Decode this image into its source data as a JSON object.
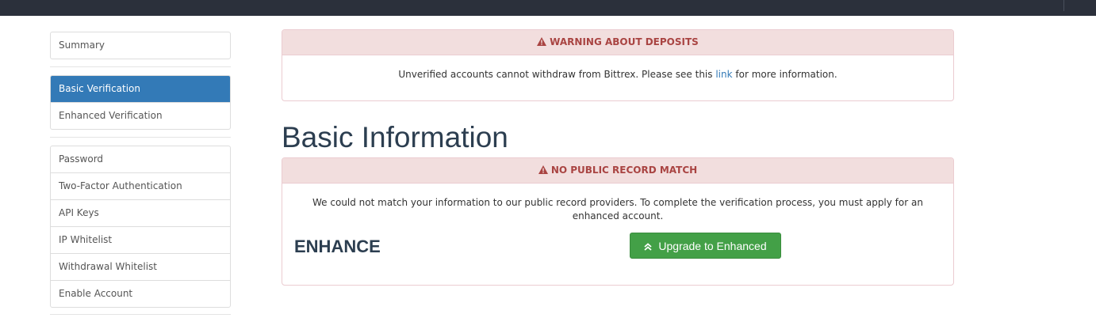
{
  "sidebar": {
    "group1": [
      {
        "label": "Summary"
      }
    ],
    "group2": [
      {
        "label": "Basic Verification",
        "active": true
      },
      {
        "label": "Enhanced Verification"
      }
    ],
    "group3": [
      {
        "label": "Password"
      },
      {
        "label": "Two-Factor Authentication"
      },
      {
        "label": "API Keys"
      },
      {
        "label": "IP Whitelist"
      },
      {
        "label": "Withdrawal Whitelist"
      },
      {
        "label": "Enable Account"
      }
    ]
  },
  "deposit_warning": {
    "title": "WARNING ABOUT DEPOSITS",
    "text_before": "Unverified accounts cannot withdraw from Bittrex. Please see this ",
    "link_text": "link",
    "text_after": " for more information."
  },
  "page": {
    "title": "Basic Information"
  },
  "record_warning": {
    "title": "NO PUBLIC RECORD MATCH",
    "message": "We could not match your information to our public record providers. To complete the verification process, you must apply for an enhanced account.",
    "enhance_label": "ENHANCE",
    "upgrade_button": "Upgrade to Enhanced"
  },
  "colors": {
    "topbar": "#2b303b",
    "active_nav": "#337ab7",
    "alert_heading_bg": "#f2dede",
    "alert_text": "#a94442",
    "success_button": "#43a047"
  },
  "icons": {
    "warning": "warning-triangle-icon",
    "upgrade": "double-chevron-up-icon"
  }
}
